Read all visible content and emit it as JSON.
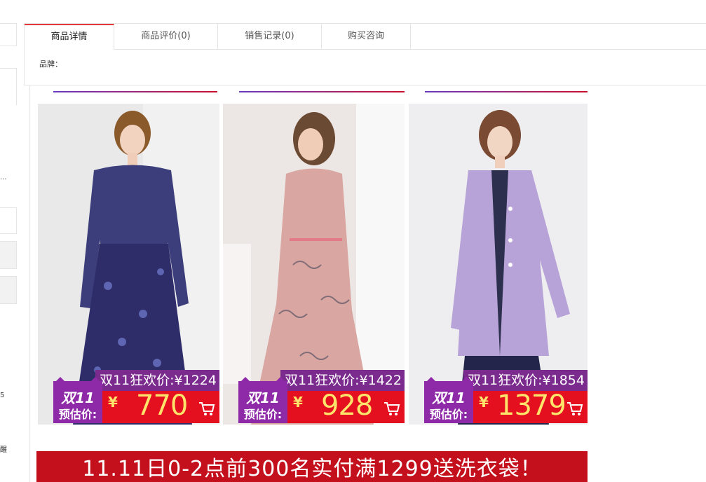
{
  "tabs": [
    {
      "label": "商品详情"
    },
    {
      "label": "商品评价(0)"
    },
    {
      "label": "销售记录(0)"
    },
    {
      "label": "购买咨询"
    }
  ],
  "brand_label": "品牌：",
  "left_strip": {
    "frag1": "...",
    "frag2": "5",
    "frag3": "醒"
  },
  "products": [
    {
      "orig_label": "双11狂欢价:",
      "orig_price": "¥1224",
      "badge_line1": "双11",
      "badge_line2": "预估价:",
      "currency": "¥",
      "price": "770",
      "color": "#3b3e7a"
    },
    {
      "orig_label": "双11狂欢价:",
      "orig_price": "¥1422",
      "badge_line1": "双11",
      "badge_line2": "预估价:",
      "currency": "¥",
      "price": "928",
      "color": "#d9a6a1"
    },
    {
      "orig_label": "双11狂欢价:",
      "orig_price": "¥1854",
      "badge_line1": "双11",
      "badge_line2": "预估价:",
      "currency": "¥",
      "price": "1379",
      "color": "#b8a3d8"
    }
  ],
  "banner_text": "11.11日0-2点前300名实付满1299送洗衣袋！",
  "colors": {
    "accent_red": "#e40f1f",
    "badge_purple": "#8e2aa8",
    "price_yellow": "#ffe46b",
    "banner_red": "#c4101c"
  }
}
